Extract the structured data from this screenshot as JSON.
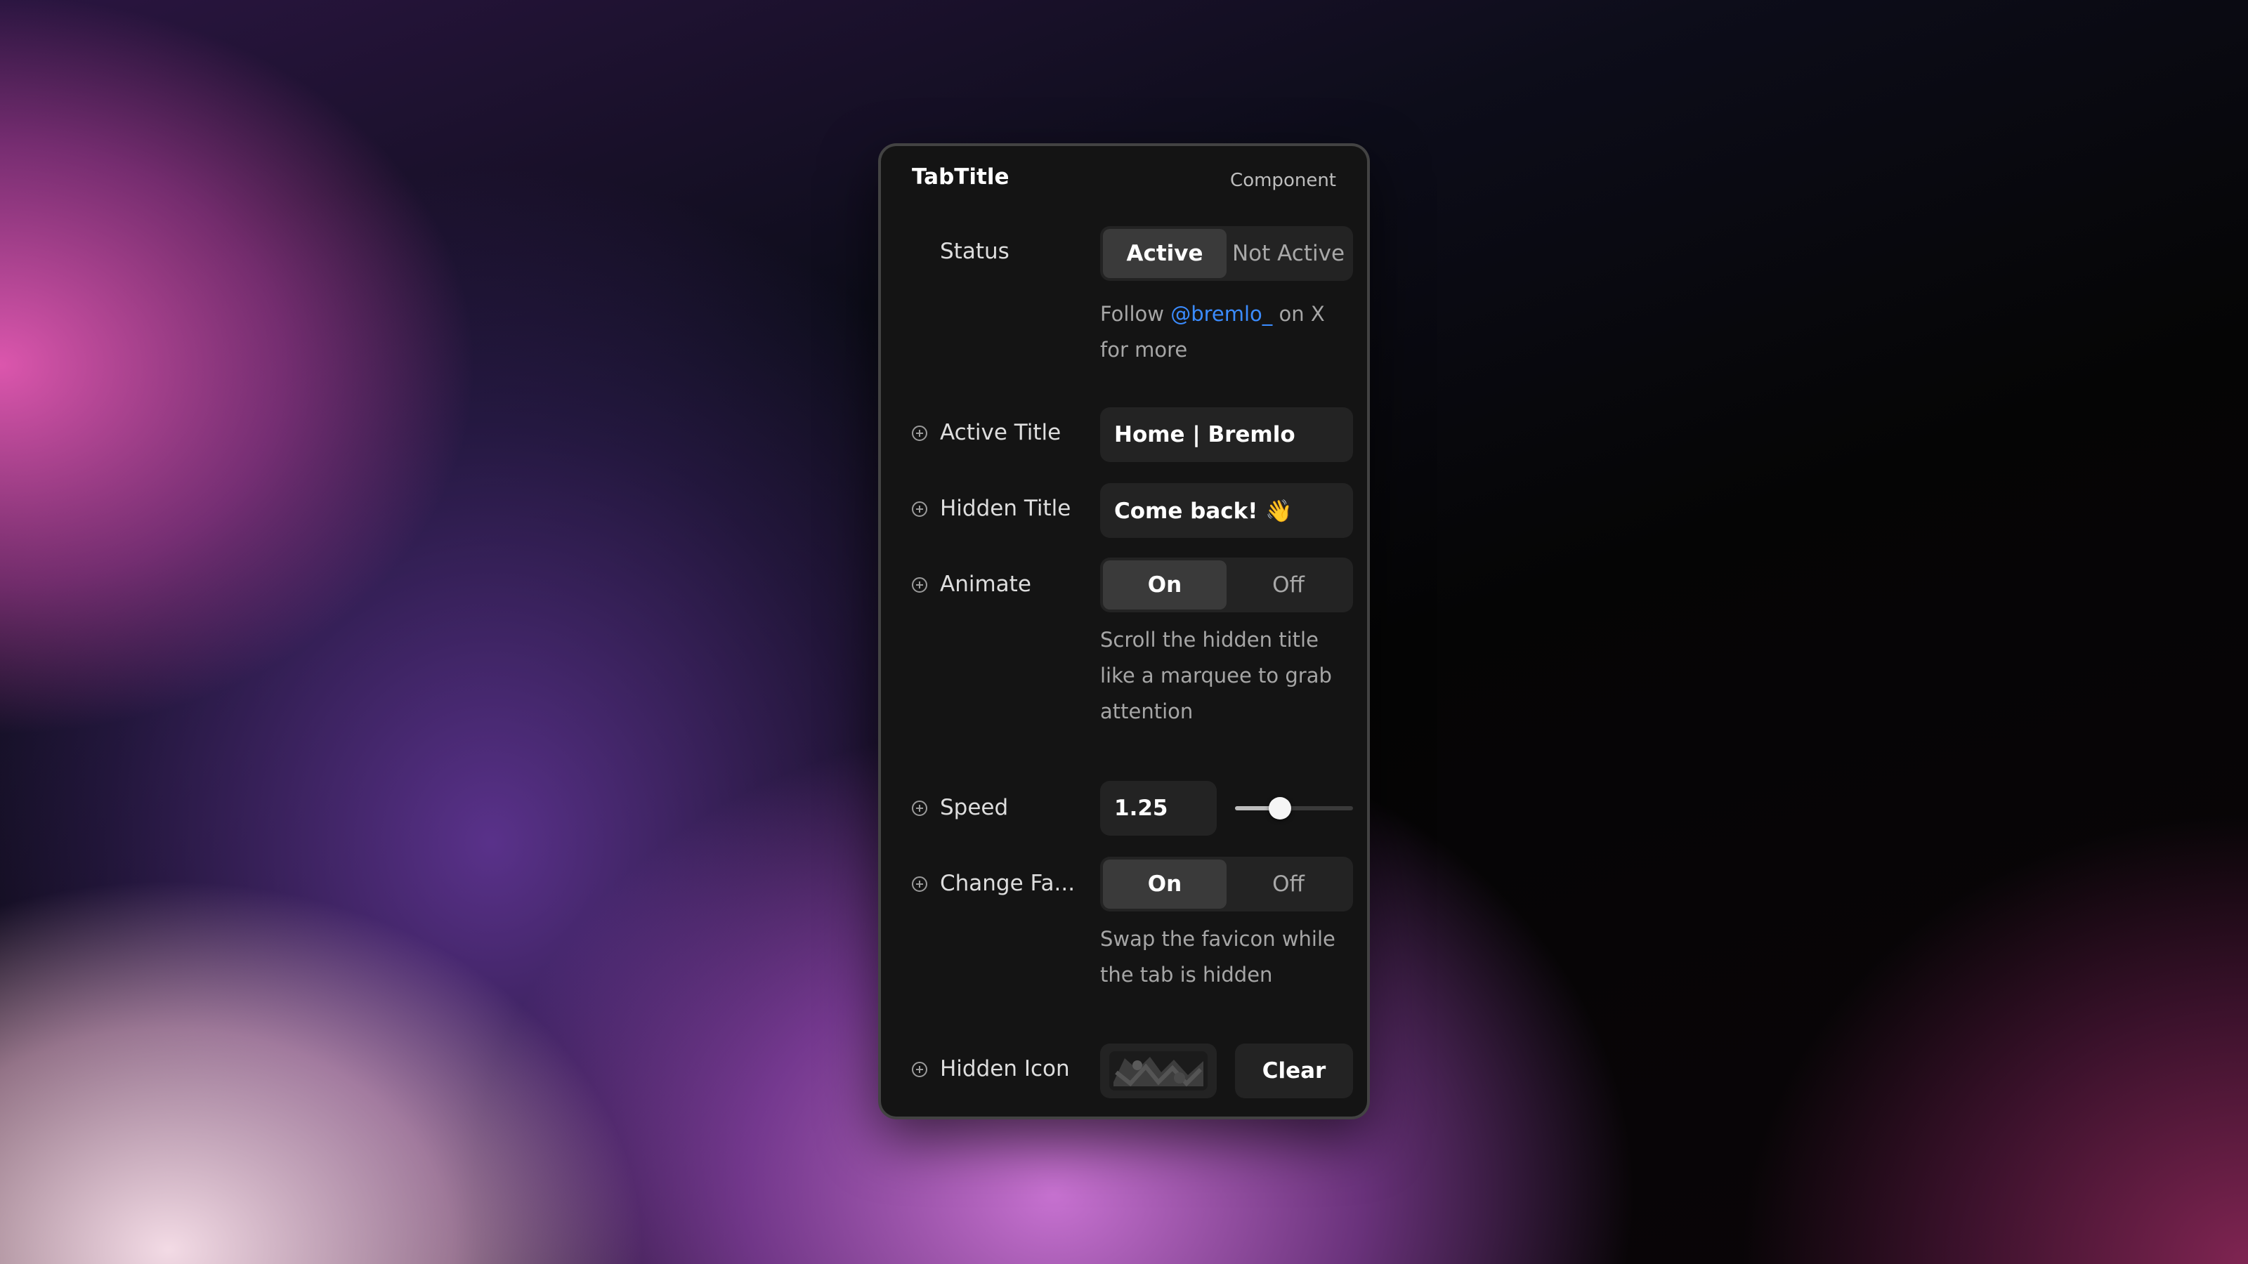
{
  "panel": {
    "title": "TabTitle",
    "subtitle": "Component"
  },
  "status": {
    "label": "Status",
    "options": [
      "Active",
      "Not Active"
    ],
    "selected": "Active"
  },
  "follow": {
    "prefix": "Follow ",
    "handle": "@bremlo_",
    "suffix": " on X",
    "line2": "for more"
  },
  "active_title": {
    "label": "Active Title",
    "value": "Home | Bremlo"
  },
  "hidden_title": {
    "label": "Hidden Title",
    "value": "Come back! 👋"
  },
  "animate": {
    "label": "Animate",
    "options": [
      "On",
      "Off"
    ],
    "selected": "On",
    "description_lines": [
      "Scroll the hidden title",
      "like a marquee to grab",
      "attention"
    ]
  },
  "speed": {
    "label": "Speed",
    "value": "1.25",
    "slider_fraction": 0.38
  },
  "change_favicon": {
    "label": "Change Fa...",
    "options": [
      "On",
      "Off"
    ],
    "selected": "On",
    "description_lines": [
      "Swap the favicon while",
      "the tab is hidden"
    ]
  },
  "hidden_icon": {
    "label": "Hidden Icon",
    "clear_label": "Clear"
  },
  "colors": {
    "link": "#3b8cff",
    "panel_bg": "#141414"
  }
}
